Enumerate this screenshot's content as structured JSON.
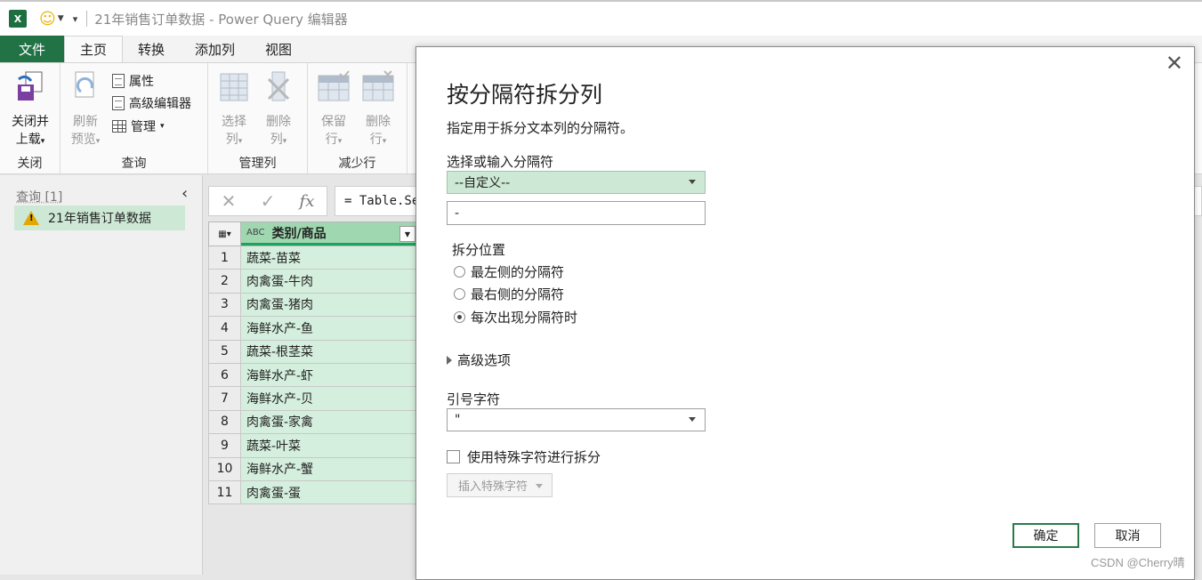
{
  "titlebar": {
    "app_icon": "excel-icon",
    "title": "21年销售订单数据 - Power Query 编辑器"
  },
  "ribbon_tabs": [
    "文件",
    "主页",
    "转换",
    "添加列",
    "视图"
  ],
  "ribbon": {
    "close_group": {
      "button": [
        "关闭并",
        "上载"
      ],
      "label": "关闭"
    },
    "query_group": {
      "refresh": [
        "刷新",
        "预览"
      ],
      "properties": "属性",
      "advanced_editor": "高级编辑器",
      "manage": "管理",
      "label": "查询"
    },
    "manage_cols_group": {
      "choose": [
        "选择",
        "列"
      ],
      "remove": [
        "删除",
        "列"
      ],
      "label": "管理列"
    },
    "reduce_rows_group": {
      "keep": [
        "保留",
        "行"
      ],
      "remove": [
        "删除",
        "行"
      ],
      "label": "减少行"
    }
  },
  "query_pane": {
    "title": "查询 [1]",
    "items": [
      "21年销售订单数据"
    ]
  },
  "formula_bar": {
    "formula": "= Table.Se"
  },
  "grid": {
    "column_header": "类别/商品",
    "type_badge": "ABC",
    "rows": [
      "蔬菜-苗菜",
      "肉禽蛋-牛肉",
      "肉禽蛋-猪肉",
      "海鲜水产-鱼",
      "蔬菜-根茎菜",
      "海鲜水产-虾",
      "海鲜水产-贝",
      "肉禽蛋-家禽",
      "蔬菜-叶菜",
      "海鲜水产-蟹",
      "肉禽蛋-蛋"
    ]
  },
  "dialog": {
    "title": "按分隔符拆分列",
    "description": "指定用于拆分文本列的分隔符。",
    "delimiter_label": "选择或输入分隔符",
    "delimiter_selected": "--自定义--",
    "delimiter_value": "-",
    "split_at_label": "拆分位置",
    "split_options": [
      "最左侧的分隔符",
      "最右侧的分隔符",
      "每次出现分隔符时"
    ],
    "split_selected_index": 2,
    "advanced_label": "高级选项",
    "quote_label": "引号字符",
    "quote_value": "\"",
    "special_chars_label": "使用特殊字符进行拆分",
    "insert_special": "插入特殊字符",
    "ok": "确定",
    "cancel": "取消"
  },
  "watermark": "CSDN @Cherry晴",
  "colors": {
    "accent": "#217346",
    "selected_bg": "#cde8d4",
    "column_header": "#9fd7b0"
  }
}
